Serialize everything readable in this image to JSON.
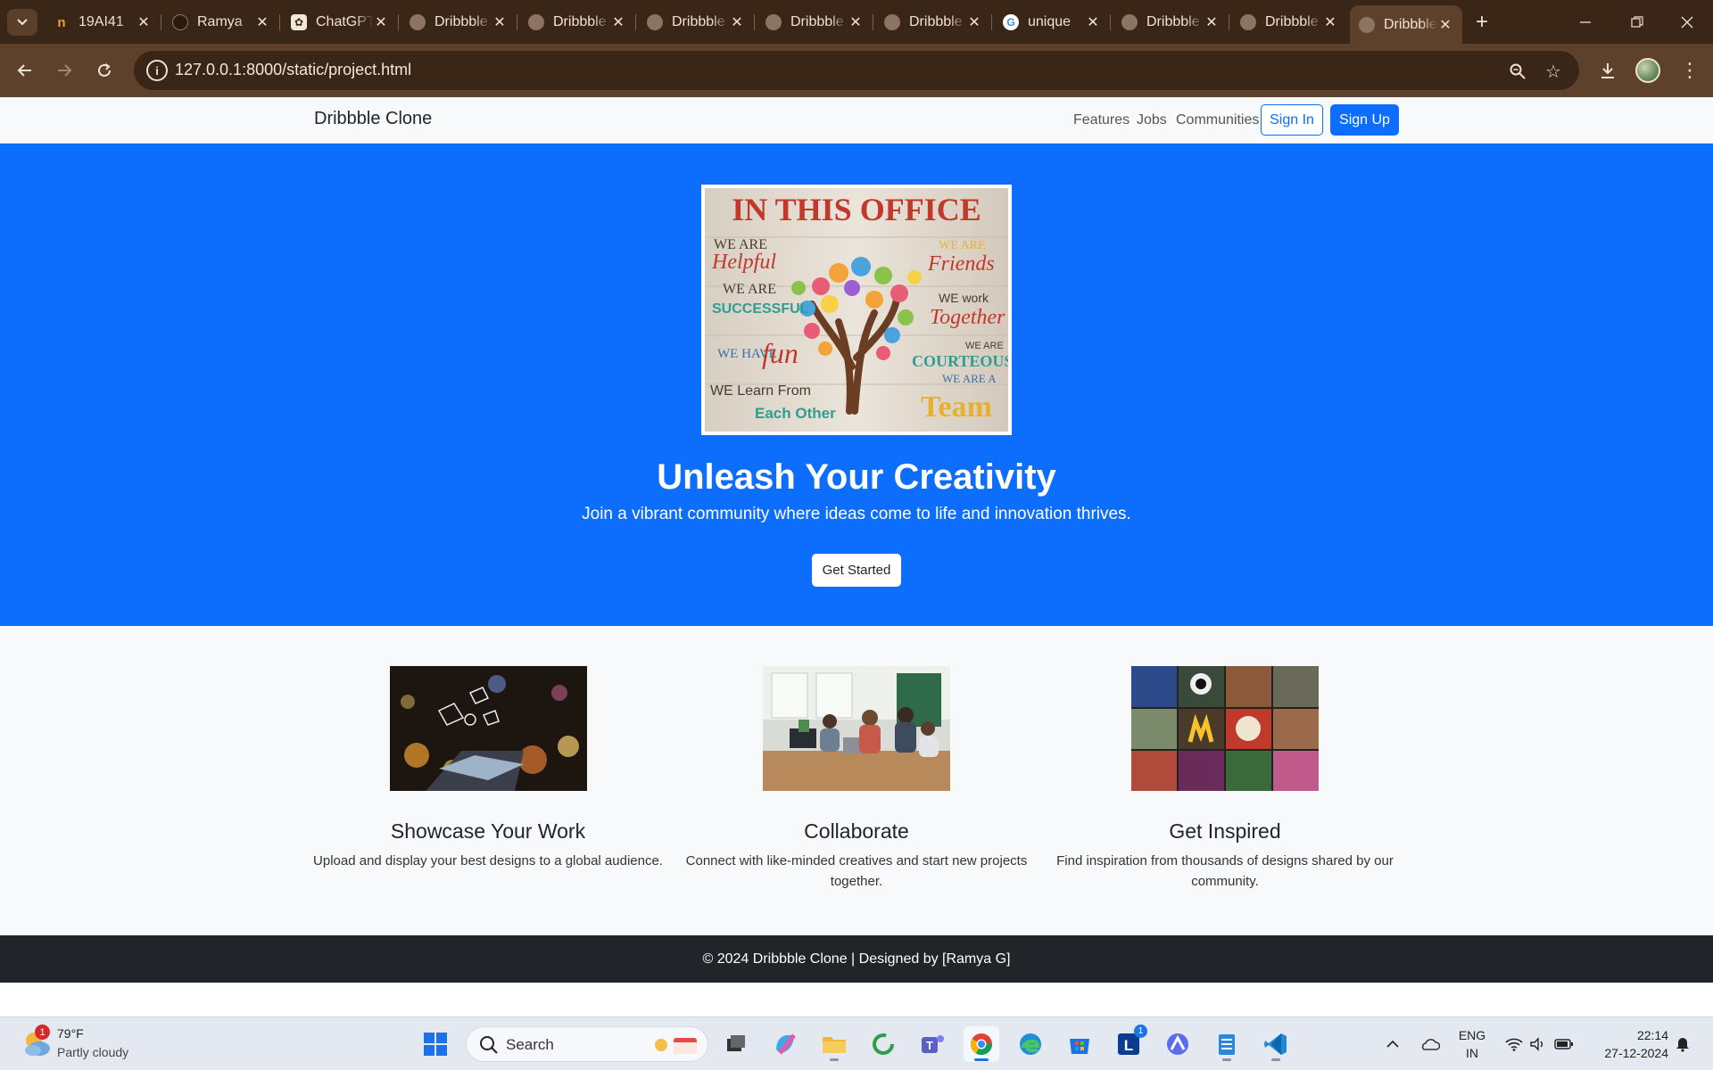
{
  "browser": {
    "tabs": [
      {
        "label": "19AI41",
        "favicon": "n"
      },
      {
        "label": "Ramya",
        "favicon": "github"
      },
      {
        "label": "ChatGPT",
        "favicon": "chatgpt"
      },
      {
        "label": "Dribbble",
        "favicon": "globe"
      },
      {
        "label": "Dribbble",
        "favicon": "globe"
      },
      {
        "label": "Dribbble",
        "favicon": "globe"
      },
      {
        "label": "Dribbble",
        "favicon": "globe"
      },
      {
        "label": "Dribbble",
        "favicon": "globe"
      },
      {
        "label": "unique",
        "favicon": "google"
      },
      {
        "label": "Dribbble",
        "favicon": "globe"
      },
      {
        "label": "Dribbble",
        "favicon": "globe"
      },
      {
        "label": "Dribbble",
        "favicon": "globe",
        "active": true
      }
    ],
    "url": "127.0.0.1:8000/static/project.html"
  },
  "site": {
    "brand": "Dribbble Clone",
    "nav": {
      "features": "Features",
      "jobs": "Jobs",
      "communities": "Communities",
      "sign_in": "Sign In",
      "sign_up": "Sign Up"
    },
    "hero": {
      "poster": {
        "headline": "IN THIS OFFICE",
        "lines": {
          "we_are_1": "WE ARE",
          "helpful": "Helpful",
          "we_are_2": "WE ARE",
          "successful": "SUCCESSFUL",
          "we_have": "WE HAVE",
          "fun": "fun",
          "we_learn": "WE Learn From",
          "each_other": "Each Other",
          "we_are_3": "WE ARE",
          "friends": "Friends",
          "we_work": "WE work",
          "together": "Together",
          "we_are_4": "WE ARE",
          "courteous": "COURTEOUS",
          "we_are_a": "WE ARE A",
          "team": "Team"
        }
      },
      "title": "Unleash Your Creativity",
      "subtitle": "Join a vibrant community where ideas come to life and innovation thrives.",
      "cta": "Get Started"
    },
    "features": [
      {
        "title": "Showcase Your Work",
        "text": "Upload and display your best designs to a global audience."
      },
      {
        "title": "Collaborate",
        "text": "Connect with like-minded creatives and start new projects together."
      },
      {
        "title": "Get Inspired",
        "text": "Find inspiration from thousands of designs shared by our community."
      }
    ],
    "footer": "© 2024 Dribbble Clone | Designed by [Ramya G]"
  },
  "taskbar": {
    "weather": {
      "temp": "79°F",
      "desc": "Partly cloudy",
      "badge": "1"
    },
    "search_placeholder": "Search",
    "lang": {
      "line1": "ENG",
      "line2": "IN"
    },
    "clock": {
      "time": "22:14",
      "date": "27-12-2024"
    },
    "notification_badge": "1"
  },
  "colors": {
    "primary": "#0d6efd",
    "chrome_dark": "#3a2617",
    "chrome_mid": "#5e412b",
    "footer": "#212529"
  }
}
